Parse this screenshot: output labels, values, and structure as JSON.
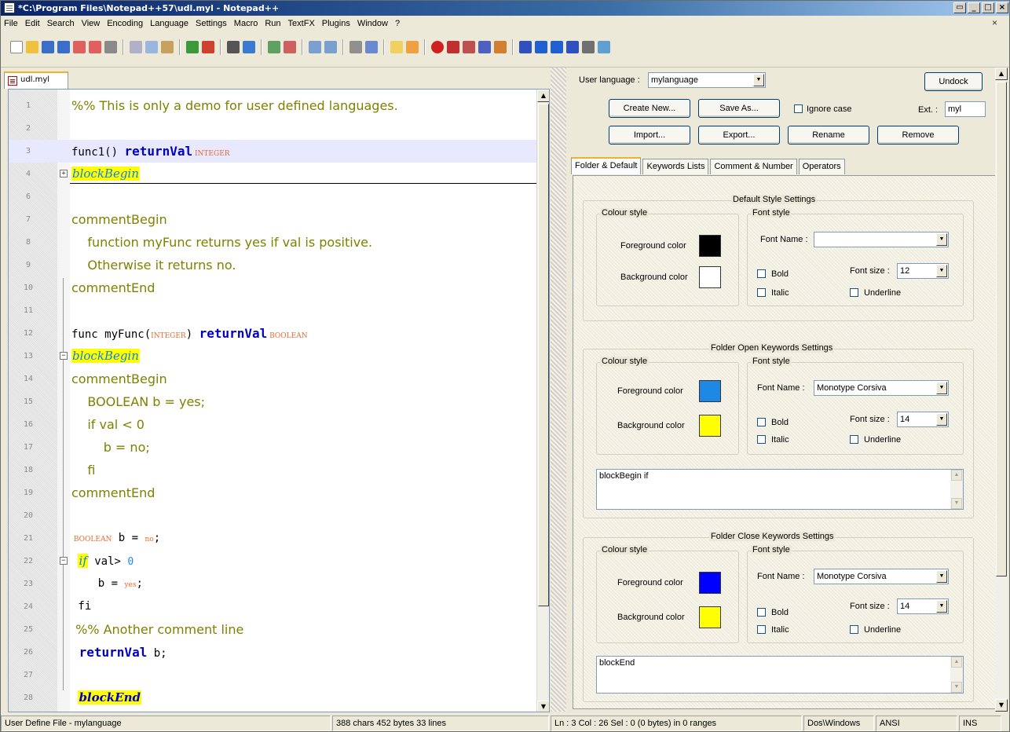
{
  "window": {
    "title": "*C:\\Program Files\\Notepad++57\\udl.myl - Notepad++"
  },
  "menu": [
    "File",
    "Edit",
    "Search",
    "View",
    "Encoding",
    "Language",
    "Settings",
    "Macro",
    "Run",
    "TextFX",
    "Plugins",
    "Window",
    "?"
  ],
  "tab": {
    "label": "udl.myl"
  },
  "editor": {
    "lines": [
      {
        "n": "1",
        "parts": [
          {
            "t": "%% This is only a demo for user defined languages.",
            "c": "cmt"
          }
        ]
      },
      {
        "n": "2",
        "parts": []
      },
      {
        "n": "3",
        "parts": [
          {
            "t": "func1() ",
            "c": "mono"
          },
          {
            "t": "returnVal",
            "c": "kw"
          },
          {
            "t": " INTEGER",
            "c": "kw2"
          }
        ]
      },
      {
        "n": "4",
        "parts": [
          {
            "t": "blockBegin",
            "c": "blk"
          }
        ]
      },
      {
        "n": "6",
        "parts": []
      },
      {
        "n": "7",
        "parts": [
          {
            "t": "commentBegin",
            "c": "cmt"
          }
        ]
      },
      {
        "n": "8",
        "parts": [
          {
            "t": "    function myFunc returns yes if val is positive.",
            "c": "cmt"
          }
        ]
      },
      {
        "n": "9",
        "parts": [
          {
            "t": "    Otherwise it returns no.",
            "c": "cmt"
          }
        ]
      },
      {
        "n": "10",
        "parts": [
          {
            "t": "commentEnd",
            "c": "cmt"
          }
        ]
      },
      {
        "n": "11",
        "parts": []
      },
      {
        "n": "12",
        "parts": [
          {
            "t": "func myFunc(",
            "c": "mono"
          },
          {
            "t": "INTEGER",
            "c": "kw2"
          },
          {
            "t": ") ",
            "c": "mono"
          },
          {
            "t": "returnVal",
            "c": "kw"
          },
          {
            "t": " BOOLEAN",
            "c": "kw2"
          }
        ]
      },
      {
        "n": "13",
        "parts": [
          {
            "t": "blockBegin",
            "c": "blk"
          }
        ]
      },
      {
        "n": "14",
        "parts": [
          {
            "t": "commentBegin",
            "c": "cmt"
          }
        ]
      },
      {
        "n": "15",
        "parts": [
          {
            "t": "    BOOLEAN b = yes;",
            "c": "cmt"
          }
        ]
      },
      {
        "n": "16",
        "parts": [
          {
            "t": "    if val < 0",
            "c": "cmt"
          }
        ]
      },
      {
        "n": "17",
        "parts": [
          {
            "t": "        b = no;",
            "c": "cmt"
          }
        ]
      },
      {
        "n": "18",
        "parts": [
          {
            "t": "    fi",
            "c": "cmt"
          }
        ]
      },
      {
        "n": "19",
        "parts": [
          {
            "t": "commentEnd",
            "c": "cmt"
          }
        ]
      },
      {
        "n": "20",
        "parts": []
      },
      {
        "n": "21",
        "parts": [
          {
            "t": " BOOLEAN",
            "c": "kw2"
          },
          {
            "t": " b = ",
            "c": "mono"
          },
          {
            "t": "no",
            "c": "kw2"
          },
          {
            "t": ";",
            "c": "mono"
          }
        ]
      },
      {
        "n": "22",
        "parts": [
          {
            "t": " ",
            "c": "mono"
          },
          {
            "t": "if",
            "c": "blk"
          },
          {
            "t": " val> ",
            "c": "mono"
          },
          {
            "t": "0",
            "c": "num"
          }
        ]
      },
      {
        "n": "23",
        "parts": [
          {
            "t": "    b = ",
            "c": "mono"
          },
          {
            "t": "yes",
            "c": "kw2"
          },
          {
            "t": ";",
            "c": "mono"
          }
        ]
      },
      {
        "n": "24",
        "parts": [
          {
            "t": " fi",
            "c": "mono"
          }
        ]
      },
      {
        "n": "25",
        "parts": [
          {
            "t": " %% Another comment line",
            "c": "cmt"
          }
        ]
      },
      {
        "n": "26",
        "parts": [
          {
            "t": " returnVal",
            "c": "kw"
          },
          {
            "t": " b;",
            "c": "mono"
          }
        ]
      },
      {
        "n": "27",
        "parts": []
      },
      {
        "n": "28",
        "parts": [
          {
            "t": " ",
            "c": "mono"
          },
          {
            "t": "blockEnd",
            "c": "blke"
          }
        ]
      }
    ]
  },
  "udl": {
    "user_language_label": "User language :",
    "user_language_value": "mylanguage",
    "undock": "Undock",
    "create_new": "Create New...",
    "save_as": "Save As...",
    "ignore_case": "Ignore case",
    "ext_label": "Ext. :",
    "ext_value": "myl",
    "import": "Import...",
    "export": "Export...",
    "rename": "Rename",
    "remove": "Remove",
    "tabs": [
      "Folder & Default",
      "Keywords Lists",
      "Comment & Number",
      "Operators"
    ],
    "groups": {
      "default": {
        "title": "Default Style Settings",
        "colour_style": "Colour style",
        "font_style": "Font style",
        "fg": "Foreground color",
        "bg": "Background color",
        "font_name_label": "Font Name :",
        "font_name": "",
        "bold": "Bold",
        "italic": "Italic",
        "font_size_label": "Font size :",
        "font_size": "12",
        "underline": "Underline",
        "fg_color": "#000000",
        "bg_color": "#ffffff"
      },
      "open": {
        "title": "Folder Open Keywords Settings",
        "colour_style": "Colour style",
        "font_style": "Font style",
        "fg": "Foreground color",
        "bg": "Background color",
        "font_name_label": "Font Name :",
        "font_name": "Monotype Corsiva",
        "bold": "Bold",
        "italic": "Italic",
        "font_size_label": "Font size :",
        "font_size": "14",
        "underline": "Underline",
        "fg_color": "#1e88e5",
        "bg_color": "#ffff00",
        "keywords": "blockBegin if"
      },
      "close": {
        "title": "Folder Close Keywords Settings",
        "colour_style": "Colour style",
        "font_style": "Font style",
        "fg": "Foreground color",
        "bg": "Background color",
        "font_name_label": "Font Name :",
        "font_name": "Monotype Corsiva",
        "bold": "Bold",
        "italic": "Italic",
        "font_size_label": "Font size :",
        "font_size": "14",
        "underline": "Underline",
        "fg_color": "#0000ff",
        "bg_color": "#ffff00",
        "keywords": "blockEnd"
      }
    }
  },
  "status": {
    "file_type": "User Define File - mylanguage",
    "counts": "388 chars  452 bytes  33 lines",
    "position": "Ln : 3    Col : 26    Sel : 0 (0 bytes) in 0 ranges",
    "eol": "Dos\\Windows",
    "encoding": "ANSI",
    "mode": "INS"
  }
}
